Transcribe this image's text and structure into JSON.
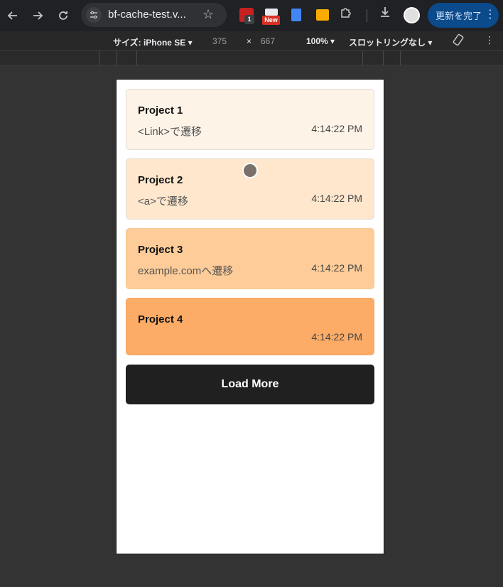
{
  "browser": {
    "url": "bf-cache-test.v...",
    "ext_red_badge": "1",
    "ext_new_badge": "New",
    "update_label": "更新を完了"
  },
  "device_toolbar": {
    "size_label": "サイズ: iPhone SE ▾",
    "width": "375",
    "times": "×",
    "height": "667",
    "zoom": "100% ▾",
    "throttle": "スロットリングなし ▾"
  },
  "projects": [
    {
      "title": "Project 1",
      "subtitle": "<Link>で遷移",
      "time": "4:14:22 PM"
    },
    {
      "title": "Project 2",
      "subtitle": "<a>で遷移",
      "time": "4:14:22 PM"
    },
    {
      "title": "Project 3",
      "subtitle": "example.comへ遷移",
      "time": "4:14:22 PM"
    },
    {
      "title": "Project 4",
      "subtitle": "",
      "time": "4:14:22 PM"
    }
  ],
  "load_more_label": "Load More",
  "colors": {
    "card1": "#fdf3e7",
    "card2": "#fee7cc",
    "card3": "#fdcc98",
    "card4": "#fcac66",
    "button": "#202020",
    "update_button": "#0b4a8b"
  }
}
